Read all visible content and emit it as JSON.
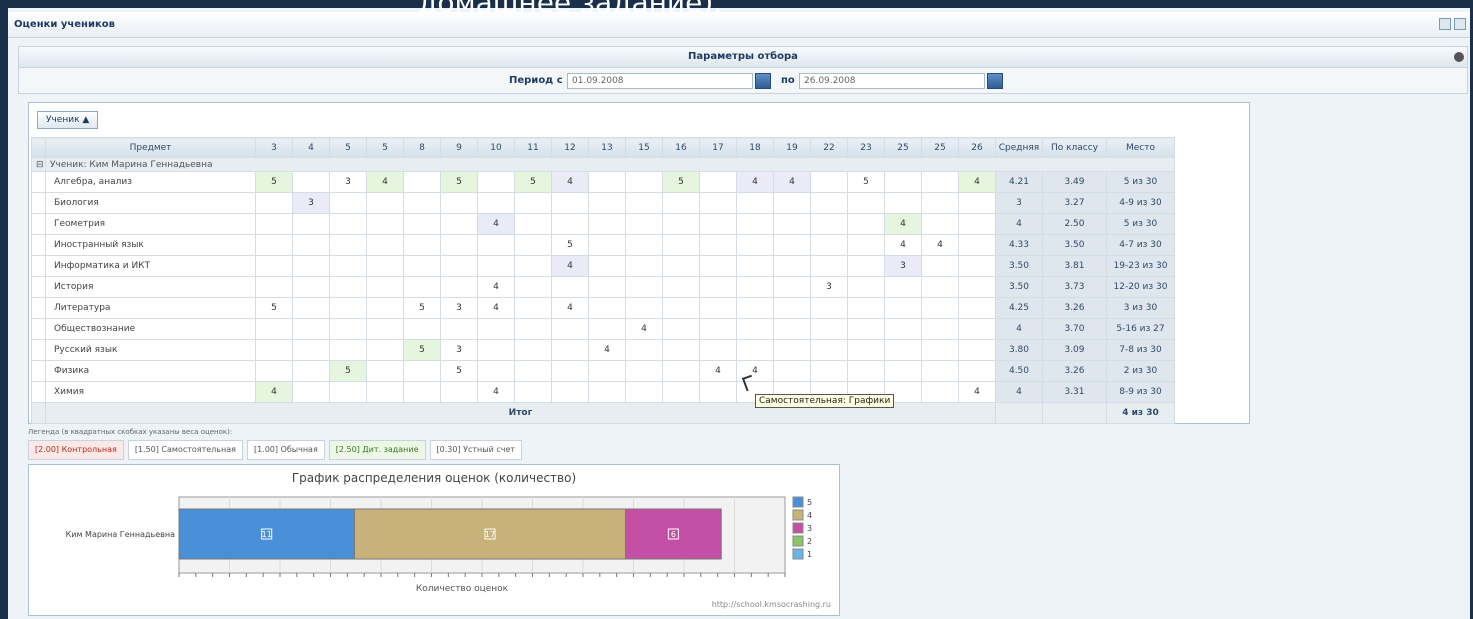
{
  "caption": "домашнее задание).",
  "module": {
    "title": "Оценки учеников"
  },
  "filter": {
    "title": "Параметры отбора",
    "period_from_label": "Период с",
    "period_from": "01.09.2008",
    "period_to_label": "по",
    "period_to": "26.09.2008"
  },
  "toolbar": {
    "group_button": "Ученик ▲"
  },
  "table": {
    "subject_header": "Предмет",
    "days": [
      "3",
      "4",
      "5",
      "5",
      "8",
      "9",
      "10",
      "11",
      "12",
      "13",
      "15",
      "16",
      "17",
      "18",
      "19",
      "22",
      "23",
      "25",
      "25",
      "26"
    ],
    "avg_header": "Средняя",
    "class_header": "По классу",
    "place_header": "Место",
    "group_label": "Ученик: Ким Марина Геннадьевна",
    "rows": [
      {
        "subject": "Алгебра, анализ",
        "grades": [
          "5",
          "",
          "3",
          "4",
          "",
          "5",
          "",
          "5",
          "4",
          "",
          "",
          "5",
          "",
          "4",
          "4",
          "",
          "5",
          "",
          "",
          "4"
        ],
        "avg": "4.21",
        "class_avg": "3.49",
        "place": "5 из 30"
      },
      {
        "subject": "Биология",
        "grades": [
          "",
          "3",
          "",
          "",
          "",
          "",
          "",
          "",
          "",
          "",
          "",
          "",
          "",
          "",
          "",
          "",
          "",
          "",
          "",
          ""
        ],
        "avg": "3",
        "class_avg": "3.27",
        "place": "4-9 из 30"
      },
      {
        "subject": "Геометрия",
        "grades": [
          "",
          "",
          "",
          "",
          "",
          "",
          "4",
          "",
          "",
          "",
          "",
          "",
          "",
          "",
          "",
          "",
          "",
          "4",
          "",
          ""
        ],
        "avg": "4",
        "class_avg": "2.50",
        "place": "5 из 30"
      },
      {
        "subject": "Иностранный язык",
        "grades": [
          "",
          "",
          "",
          "",
          "",
          "",
          "",
          "",
          "5",
          "",
          "",
          "",
          "",
          "",
          "",
          "",
          "",
          "4",
          "4",
          ""
        ],
        "avg": "4.33",
        "class_avg": "3.50",
        "place": "4-7 из 30"
      },
      {
        "subject": "Информатика и ИКТ",
        "grades": [
          "",
          "",
          "",
          "",
          "",
          "",
          "",
          "",
          "4",
          "",
          "",
          "",
          "",
          "",
          "",
          "",
          "",
          "3",
          "",
          ""
        ],
        "avg": "3.50",
        "class_avg": "3.81",
        "place": "19-23 из 30"
      },
      {
        "subject": "История",
        "grades": [
          "",
          "",
          "",
          "",
          "",
          "",
          "4",
          "",
          "",
          "",
          "",
          "",
          "",
          "",
          "",
          "3",
          "",
          "",
          "",
          ""
        ],
        "avg": "3.50",
        "class_avg": "3.73",
        "place": "12-20 из 30"
      },
      {
        "subject": "Литература",
        "grades": [
          "5",
          "",
          "",
          "",
          "5",
          "3",
          "4",
          "",
          "4",
          "",
          "",
          "",
          "",
          "",
          "",
          "",
          "",
          "",
          "",
          ""
        ],
        "avg": "4.25",
        "class_avg": "3.26",
        "place": "3 из 30"
      },
      {
        "subject": "Обществознание",
        "grades": [
          "",
          "",
          "",
          "",
          "",
          "",
          "",
          "",
          "",
          "",
          "4",
          "",
          "",
          "",
          "",
          "",
          "",
          "",
          "",
          ""
        ],
        "avg": "4",
        "class_avg": "3.70",
        "place": "5-16 из 27"
      },
      {
        "subject": "Русский язык",
        "grades": [
          "",
          "",
          "",
          "",
          "5",
          "3",
          "",
          "",
          "",
          "4",
          "",
          "",
          "",
          "",
          "",
          "",
          "",
          "",
          "",
          ""
        ],
        "avg": "3.80",
        "class_avg": "3.09",
        "place": "7-8 из 30"
      },
      {
        "subject": "Физика",
        "grades": [
          "",
          "",
          "5",
          "",
          "",
          "5",
          "",
          "",
          "",
          "",
          "",
          "",
          "4",
          "4",
          "",
          "",
          "",
          "",
          "",
          ""
        ],
        "avg": "4.50",
        "class_avg": "3.26",
        "place": "2 из 30"
      },
      {
        "subject": "Химия",
        "grades": [
          "4",
          "",
          "",
          "",
          "",
          "",
          "4",
          "",
          "",
          "",
          "",
          "",
          "",
          "",
          "",
          "",
          "",
          "",
          "",
          "4"
        ],
        "avg": "4",
        "class_avg": "3.31",
        "place": "8-9 из 30"
      }
    ],
    "total_label": "Итог",
    "total_place": "4 из 30"
  },
  "tooltip": "Самостоятельная: Графики",
  "legend": {
    "caption": "Легенда (в квадратных скобках указаны веса оценок):",
    "items": [
      {
        "label": "[2.00] Контрольная",
        "style": "red"
      },
      {
        "label": "[1.50] Самостоятельная",
        "style": "plain"
      },
      {
        "label": "[1.00] Обычная",
        "style": "plain"
      },
      {
        "label": "[2.50] Дит. задание",
        "style": "green"
      },
      {
        "label": "[0.30] Устный счет",
        "style": "plain"
      }
    ]
  },
  "chart_data": {
    "type": "bar",
    "orientation": "horizontal-stacked",
    "title": "График распределения оценок (количество)",
    "xlabel": "Количество оценок",
    "ylabel": "",
    "categories": [
      "Ким Марина Геннадьевна"
    ],
    "series": [
      {
        "name": "5",
        "values": [
          11
        ],
        "color": "#4a90d9"
      },
      {
        "name": "4",
        "values": [
          17
        ],
        "color": "#c8b27a"
      },
      {
        "name": "3",
        "values": [
          6
        ],
        "color": "#c44fa6"
      },
      {
        "name": "2",
        "values": [
          0
        ],
        "color": "#8cc46a"
      },
      {
        "name": "1",
        "values": [
          0
        ],
        "color": "#6ab4e8"
      }
    ],
    "xlim": [
      0,
      38
    ],
    "legend_position": "right",
    "footer": "http://school.kmsocrashing.ru"
  }
}
